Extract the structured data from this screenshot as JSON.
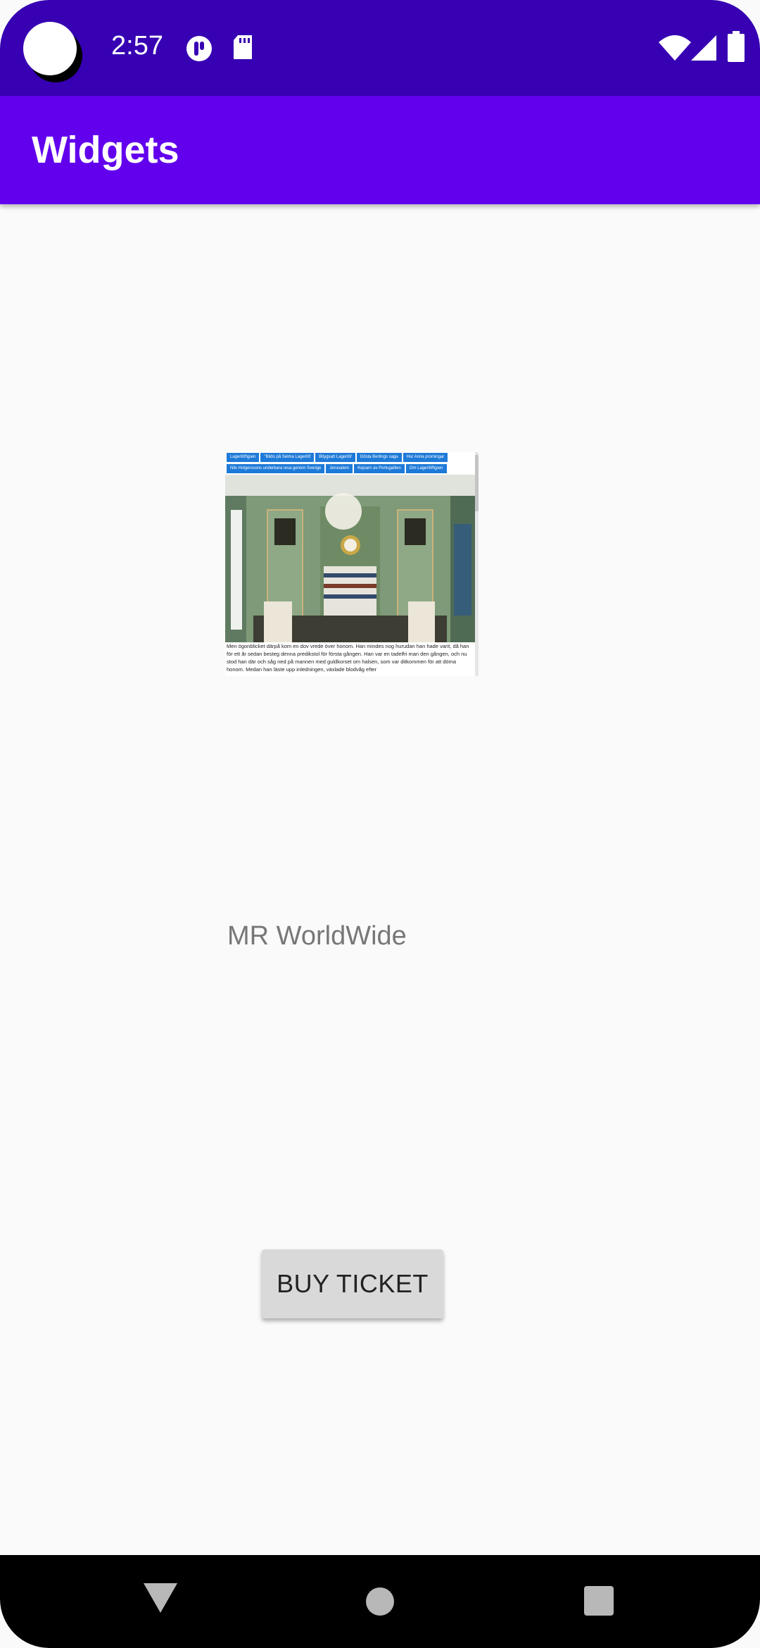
{
  "status_bar": {
    "time": "2:57",
    "icons": [
      "notification-app-icon",
      "sd-card-icon",
      "wifi-icon",
      "signal-icon",
      "battery-icon"
    ]
  },
  "app_bar": {
    "title": "Widgets"
  },
  "web_preview": {
    "tabs": [
      "Lagerlöfhjpen",
      "\"Bildo på Selma Lagerlöf",
      "Bitygsatt Lagerlöf",
      "Gösta Berlings saga",
      "Hur Anna promingar",
      "Nils Holgerssons underbara resa genom Sverige",
      "Jerusalem",
      "Kejsarn av Portugallien",
      "Om Lagerlöfhjpen"
    ],
    "body_text": "Men ögonblicket därpå kom en dov vrede över honom. Han mindes nog hurudan han hade varit, då han för ett år sedan besteg denna predikstol för första gången. Han var en tadelfri man den gången, och nu stod han där och såg ned på mannen med guldkorset om halsen, som var ditkommen för att döma honom. Medan han läste upp inledningen, växlade blodvåg efter"
  },
  "label": {
    "text": "MR WorldWide"
  },
  "buy_button": {
    "label": "BUY TICKET"
  },
  "colors": {
    "status_bar": "#3700b3",
    "app_bar": "#6200ee",
    "background": "#fafafa",
    "button": "#d9d9d9"
  }
}
